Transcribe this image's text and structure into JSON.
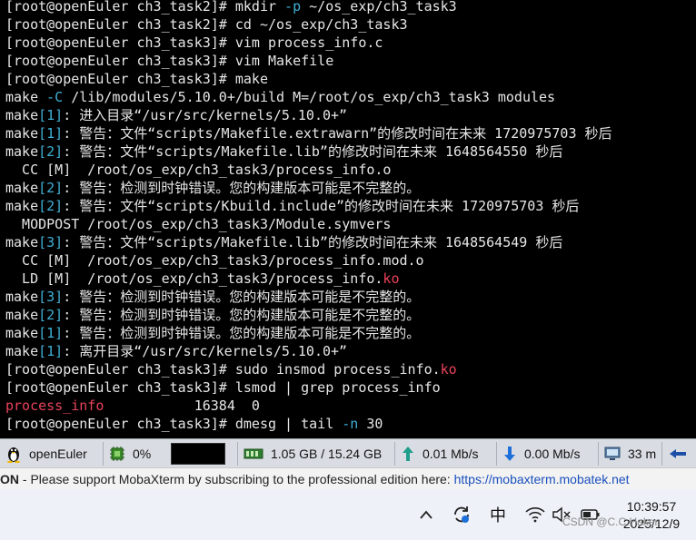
{
  "terminal": {
    "lines": [
      [
        {
          "t": "[root@openEuler ch3_task2]# mkdir ",
          "c": "white"
        },
        {
          "t": "-p",
          "c": "cyan"
        },
        {
          "t": " ~/os_exp/ch3_task3",
          "c": "white"
        }
      ],
      [
        {
          "t": "[root@openEuler ch3_task2]# cd ~/os_exp/ch3_task3",
          "c": "white"
        }
      ],
      [
        {
          "t": "[root@openEuler ch3_task3]# vim process_info.c",
          "c": "white"
        }
      ],
      [
        {
          "t": "[root@openEuler ch3_task3]# vim Makefile",
          "c": "white"
        }
      ],
      [
        {
          "t": "[root@openEuler ch3_task3]# make",
          "c": "white"
        }
      ],
      [
        {
          "t": "make ",
          "c": "white"
        },
        {
          "t": "-C",
          "c": "cyan"
        },
        {
          "t": " /lib/modules/5.10.0+/build M=/root/os_exp/ch3_task3 modules",
          "c": "white"
        }
      ],
      [
        {
          "t": "make",
          "c": "white"
        },
        {
          "t": "[1]",
          "c": "cyan"
        },
        {
          "t": ": 进入目录“/usr/src/kernels/5.10.0+”",
          "c": "white"
        }
      ],
      [
        {
          "t": "make",
          "c": "white"
        },
        {
          "t": "[1]",
          "c": "cyan"
        },
        {
          "t": ": 警告：文件“scripts/Makefile.extrawarn”的修改时间在未来 1720975703 秒后",
          "c": "white"
        }
      ],
      [
        {
          "t": "make",
          "c": "white"
        },
        {
          "t": "[2]",
          "c": "cyan"
        },
        {
          "t": ": 警告：文件“scripts/Makefile.lib”的修改时间在未来 1648564550 秒后",
          "c": "white"
        }
      ],
      [
        {
          "t": "  CC [M]  /root/os_exp/ch3_task3/process_info.o",
          "c": "white"
        }
      ],
      [
        {
          "t": "make",
          "c": "white"
        },
        {
          "t": "[2]",
          "c": "cyan"
        },
        {
          "t": ": 警告：检测到时钟错误。您的构建版本可能是不完整的。",
          "c": "white"
        }
      ],
      [
        {
          "t": "make",
          "c": "white"
        },
        {
          "t": "[2]",
          "c": "cyan"
        },
        {
          "t": ": 警告：文件“scripts/Kbuild.include”的修改时间在未来 1720975703 秒后",
          "c": "white"
        }
      ],
      [
        {
          "t": "  MODPOST /root/os_exp/ch3_task3/Module.symvers",
          "c": "white"
        }
      ],
      [
        {
          "t": "make",
          "c": "white"
        },
        {
          "t": "[3]",
          "c": "cyan"
        },
        {
          "t": ": 警告：文件“scripts/Makefile.lib”的修改时间在未来 1648564549 秒后",
          "c": "white"
        }
      ],
      [
        {
          "t": "  CC [M]  /root/os_exp/ch3_task3/process_info.mod.o",
          "c": "white"
        }
      ],
      [
        {
          "t": "  LD [M]  /root/os_exp/ch3_task3/process_info.",
          "c": "white"
        },
        {
          "t": "ko",
          "c": "red"
        }
      ],
      [
        {
          "t": "make",
          "c": "white"
        },
        {
          "t": "[3]",
          "c": "cyan"
        },
        {
          "t": ": 警告：检测到时钟错误。您的构建版本可能是不完整的。",
          "c": "white"
        }
      ],
      [
        {
          "t": "make",
          "c": "white"
        },
        {
          "t": "[2]",
          "c": "cyan"
        },
        {
          "t": ": 警告：检测到时钟错误。您的构建版本可能是不完整的。",
          "c": "white"
        }
      ],
      [
        {
          "t": "make",
          "c": "white"
        },
        {
          "t": "[1]",
          "c": "cyan"
        },
        {
          "t": ": 警告：检测到时钟错误。您的构建版本可能是不完整的。",
          "c": "white"
        }
      ],
      [
        {
          "t": "make",
          "c": "white"
        },
        {
          "t": "[1]",
          "c": "cyan"
        },
        {
          "t": ": 离开目录“/usr/src/kernels/5.10.0+”",
          "c": "white"
        }
      ],
      [
        {
          "t": "[root@openEuler ch3_task3]# sudo insmod process_info.",
          "c": "white"
        },
        {
          "t": "ko",
          "c": "red"
        }
      ],
      [
        {
          "t": "[root@openEuler ch3_task3]# lsmod | grep process_info",
          "c": "white"
        }
      ],
      [
        {
          "t": "process_info",
          "c": "red"
        },
        {
          "t": "           16384  0",
          "c": "white"
        }
      ],
      [
        {
          "t": "[root@openEuler ch3_task3]# dmesg | tail ",
          "c": "white"
        },
        {
          "t": "-n",
          "c": "cyan"
        },
        {
          "t": " 30",
          "c": "white"
        }
      ]
    ]
  },
  "statusbar": {
    "host": "openEuler",
    "cpu": "0%",
    "memory": "1.05 GB / 15.24 GB",
    "upload": "0.01 Mb/s",
    "download": "0.00 Mb/s",
    "uptime": "33 m"
  },
  "notice": {
    "prefix": "ON",
    "text": "  -  Please support MobaXterm by subscribing to the professional edition here:  ",
    "link": "https://mobaxterm.mobatek.net"
  },
  "taskbar": {
    "ime": "中",
    "time": "10:39:57",
    "date": "2025/12/9"
  },
  "watermark": "CSDN @C.C.Haker",
  "colors": {
    "white": "#e6e6e6",
    "cyan": "#3fb1d6",
    "red": "#e8425a",
    "statusbar": "#d9dde3",
    "link": "#1a4fbd"
  }
}
